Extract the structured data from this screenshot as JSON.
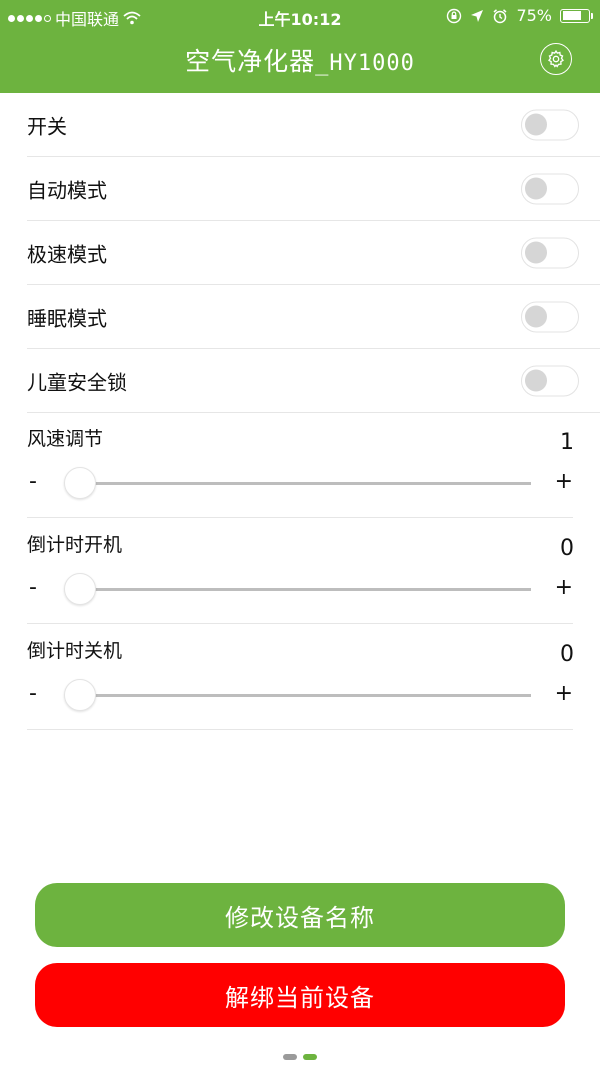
{
  "status_bar": {
    "carrier": "中国联通",
    "time": "上午10:12",
    "battery": "75%",
    "battery_level": 0.75
  },
  "header": {
    "title": "空气净化器",
    "title_suffix": "_HY1000",
    "settings_icon": "gear-icon"
  },
  "toggles": [
    {
      "label": "开关",
      "on": false
    },
    {
      "label": "自动模式",
      "on": false
    },
    {
      "label": "极速模式",
      "on": false
    },
    {
      "label": "睡眠模式",
      "on": false
    },
    {
      "label": "儿童安全锁",
      "on": false
    }
  ],
  "sliders": [
    {
      "label": "风速调节",
      "value": "1",
      "minus": "-",
      "plus": "+",
      "position": 0
    },
    {
      "label": "倒计时开机",
      "value": "0",
      "minus": "-",
      "plus": "+",
      "position": 0
    },
    {
      "label": "倒计时关机",
      "value": "0",
      "minus": "-",
      "plus": "+",
      "position": 0
    }
  ],
  "buttons": {
    "rename": "修改设备名称",
    "unbind": "解绑当前设备"
  },
  "colors": {
    "primary": "#6db33f",
    "danger": "#ff0000"
  },
  "page_indicator": {
    "count": 2,
    "active": 1
  }
}
